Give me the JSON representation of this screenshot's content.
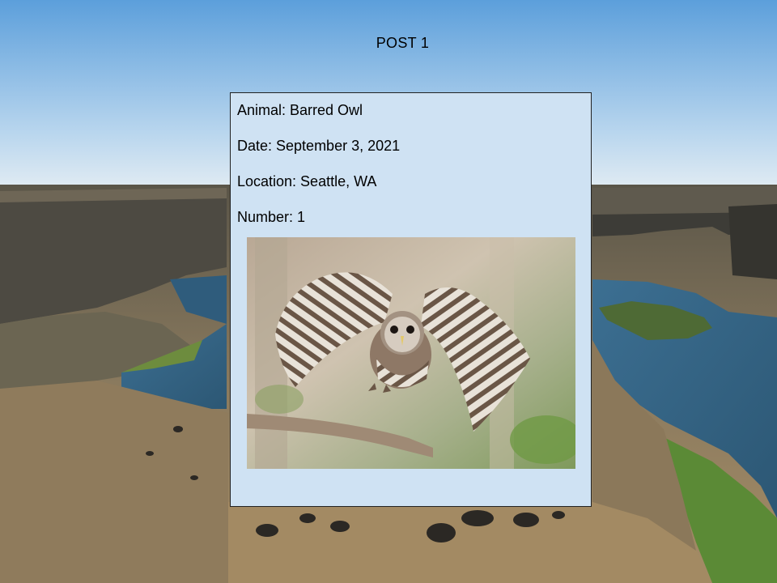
{
  "post": {
    "title": "POST 1",
    "animal": "Animal: Barred Owl",
    "date": "Date: September 3, 2021",
    "location": "Location: Seattle, WA",
    "number": "Number: 1"
  },
  "colors": {
    "card_background": "#cfe2f3",
    "card_border": "#222222",
    "sky_top": "#5b9fdc",
    "sky_horizon": "#dfeaf3"
  }
}
